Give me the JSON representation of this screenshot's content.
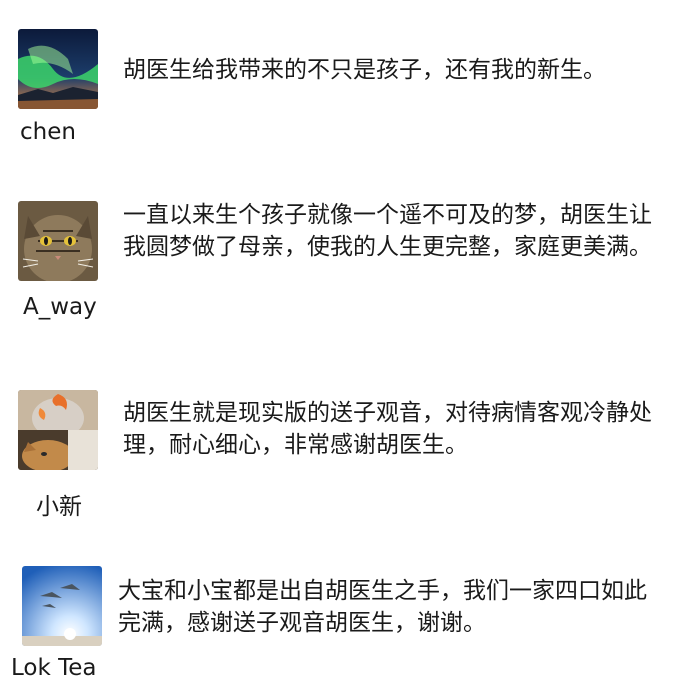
{
  "testimonials": [
    {
      "avatar": "aurora-night-sky",
      "name": "chen",
      "text": "胡医生给我带来的不只是孩子，还有我的新生。"
    },
    {
      "avatar": "tabby-cat",
      "name": "A_way",
      "text": "一直以来生个孩子就像一个遥不可及的梦，胡医生让我圆梦做了母亲，使我的人生更完整，家庭更美满。"
    },
    {
      "avatar": "cat-with-goldfish",
      "name": "小新",
      "text": "胡医生就是现实版的送子观音，对待病情客观冷静处理，耐心细心，非常感谢胡医生。"
    },
    {
      "avatar": "birds-over-beach",
      "name": "Lok Tea",
      "text": "大宝和小宝都是出自胡医生之手，我们一家四口如此完满，感谢送子观音胡医生，谢谢。"
    }
  ]
}
